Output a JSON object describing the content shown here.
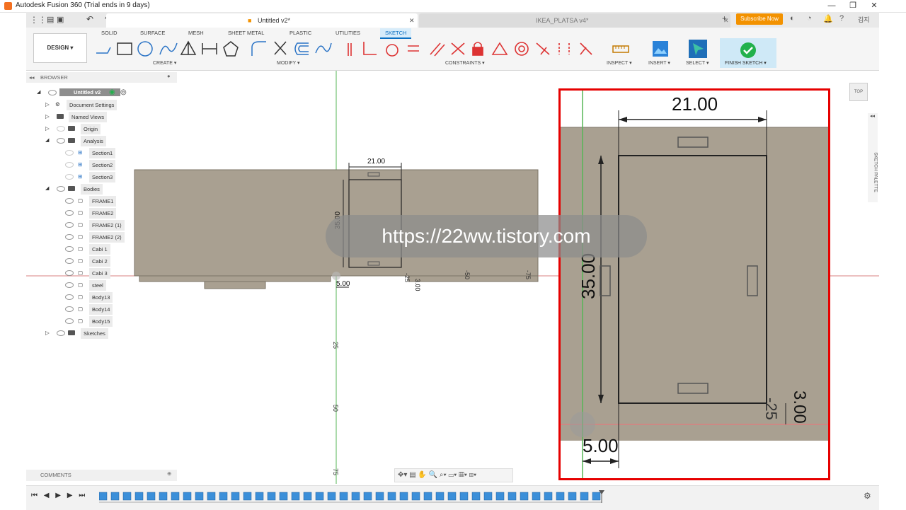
{
  "app": {
    "title": "Autodesk Fusion 360 (Trial ends in 9 days)"
  },
  "tabs": [
    {
      "label": "Untitled v2*"
    },
    {
      "label": "IKEA_PLATSA v4*"
    }
  ],
  "subscribe_label": "Subscribe Now",
  "user_initials": "김지",
  "ribbon": {
    "design_label": "DESIGN",
    "tabs": [
      "SOLID",
      "SURFACE",
      "MESH",
      "SHEET METAL",
      "PLASTIC",
      "UTILITIES",
      "SKETCH"
    ],
    "groups": [
      "CREATE",
      "MODIFY",
      "CONSTRAINTS",
      "INSPECT",
      "INSERT",
      "SELECT",
      "FINISH SKETCH"
    ]
  },
  "browser": {
    "header": "BROWSER",
    "root": "Untitled v2",
    "items": [
      {
        "label": "Document Settings"
      },
      {
        "label": "Named Views"
      },
      {
        "label": "Origin"
      },
      {
        "label": "Analysis"
      },
      {
        "label": "Section1"
      },
      {
        "label": "Section2"
      },
      {
        "label": "Section3"
      },
      {
        "label": "Bodies"
      },
      {
        "label": "FRAME1"
      },
      {
        "label": "FRAME2"
      },
      {
        "label": "FRAME2 (1)"
      },
      {
        "label": "FRAME2 (2)"
      },
      {
        "label": "Cabi 1"
      },
      {
        "label": "Cabi 2"
      },
      {
        "label": "Cabi 3"
      },
      {
        "label": "steel"
      },
      {
        "label": "Body13"
      },
      {
        "label": "Body14"
      },
      {
        "label": "Body15"
      },
      {
        "label": "Sketches"
      }
    ]
  },
  "comments_label": "COMMENTS",
  "sketch": {
    "dim_width": "21.00",
    "dim_height": "35.00",
    "dim_offset": "5.00",
    "dim_small": "3.00",
    "axis_minus25": "-25",
    "axis_minus50": "-50",
    "axis_minus75": "-75",
    "axis_25": "25",
    "axis_50": "50",
    "axis_75": "75"
  },
  "viewcube_label": "TOP",
  "sketch_palette_label": "SKETCH PALETTE",
  "watermark": "https://22ww.tistory.com"
}
